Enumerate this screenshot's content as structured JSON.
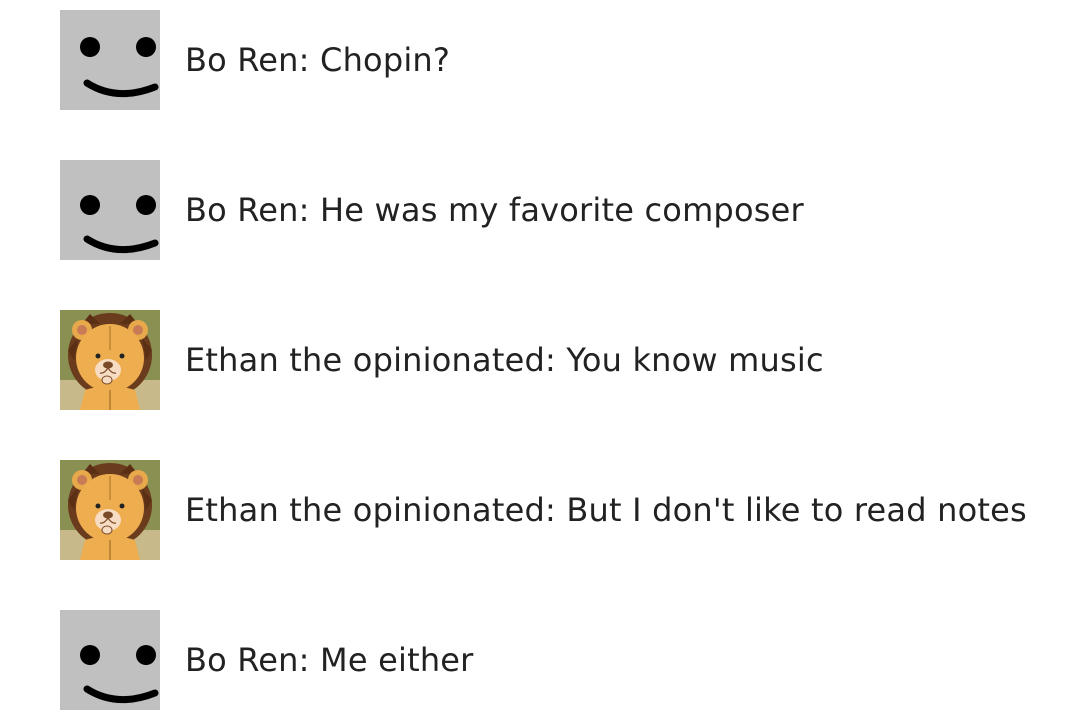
{
  "messages": [
    {
      "avatar": "smiley",
      "text": "Bo Ren: Chopin?"
    },
    {
      "avatar": "smiley",
      "text": "Bo Ren: He was my favorite composer"
    },
    {
      "avatar": "lion",
      "text": "Ethan the opinionated: You know music"
    },
    {
      "avatar": "lion",
      "text": "Ethan the opinionated: But I don't like to read notes"
    },
    {
      "avatar": "smiley",
      "text": "Bo Ren: Me either"
    }
  ],
  "icons": {
    "smiley": "smiley-avatar-icon",
    "lion": "lion-avatar-icon"
  },
  "colors": {
    "smiley_bg": "#c0c0c0",
    "smiley_face": "#000000",
    "lion_bg": "#8a8f52",
    "lion_mane": "#6a3b1c",
    "lion_face": "#e8a94a",
    "text": "#222222"
  }
}
